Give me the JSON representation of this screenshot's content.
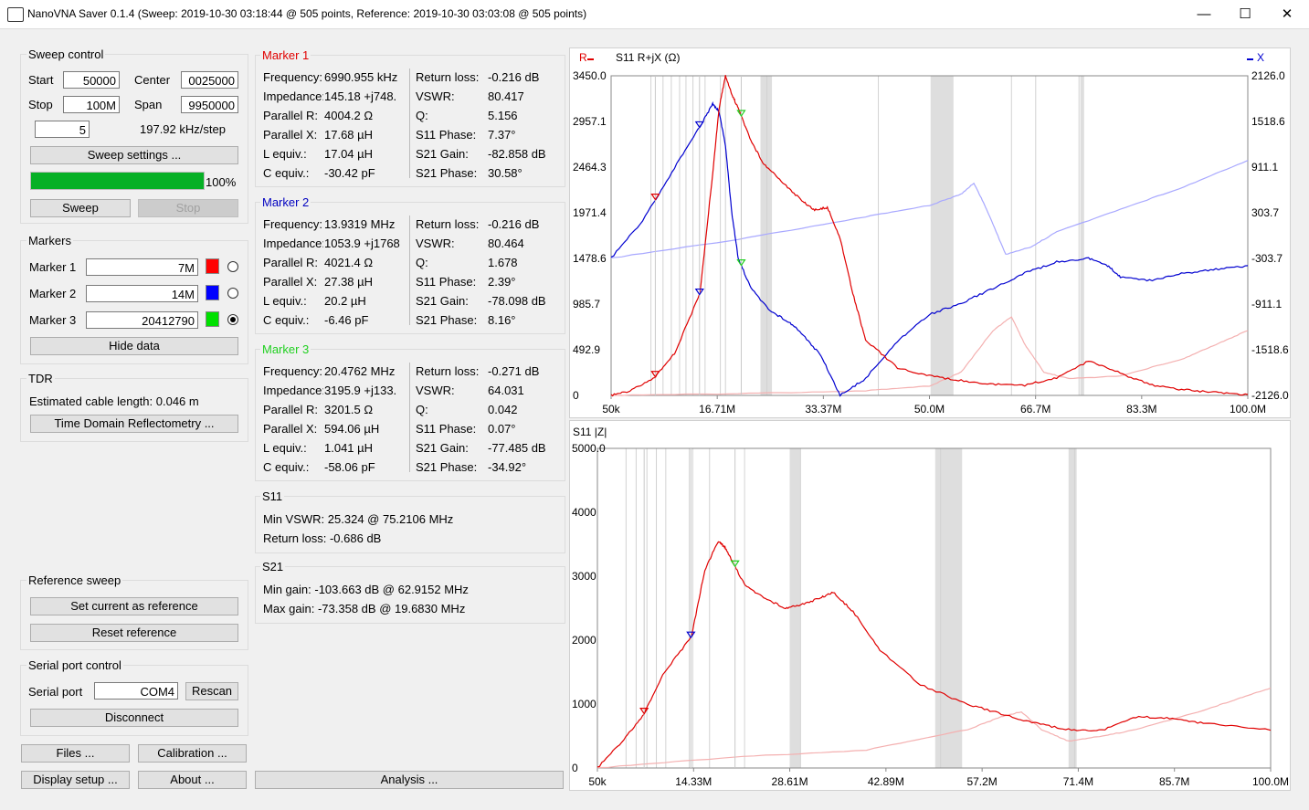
{
  "window": {
    "title": "NanoVNA Saver 0.1.4 (Sweep: 2019-10-30 03:18:44 @ 505 points, Reference: 2019-10-30 03:03:08 @ 505 points)"
  },
  "sweep": {
    "group_label": "Sweep control",
    "start_label": "Start",
    "start_value": "50000",
    "center_label": "Center",
    "center_value": "0025000",
    "stop_label": "Stop",
    "stop_value": "100M",
    "span_label": "Span",
    "span_value": "9950000",
    "count_value": "5",
    "step_text": "197.92 kHz/step",
    "settings_btn": "Sweep settings ...",
    "progress_text": "100%",
    "progress_value": 100,
    "sweep_btn": "Sweep",
    "stop_btn": "Stop"
  },
  "markers": {
    "group_label": "Markers",
    "items": [
      {
        "label": "Marker 1",
        "value": "7M",
        "color": "#ff0000",
        "selected": false
      },
      {
        "label": "Marker 2",
        "value": "14M",
        "color": "#0000ff",
        "selected": false
      },
      {
        "label": "Marker 3",
        "value": "20412790",
        "color": "#00e000",
        "selected": true
      }
    ],
    "hide_btn": "Hide data"
  },
  "tdr": {
    "group_label": "TDR",
    "cable_text": "Estimated cable length: 0.046 m",
    "btn": "Time Domain Reflectometry ..."
  },
  "reference": {
    "group_label": "Reference sweep",
    "set_btn": "Set current as reference",
    "reset_btn": "Reset reference"
  },
  "serial": {
    "group_label": "Serial port control",
    "port_label": "Serial port",
    "port_value": "COM4",
    "rescan_btn": "Rescan",
    "disconnect_btn": "Disconnect"
  },
  "bottom": {
    "files_btn": "Files ...",
    "calibration_btn": "Calibration ...",
    "display_btn": "Display setup ...",
    "about_btn": "About ...",
    "analysis_btn": "Analysis ..."
  },
  "marker_panels": [
    {
      "title": "Marker 1",
      "color": "#e00000",
      "left": [
        [
          "Frequency:",
          "6990.955 kHz"
        ],
        [
          "Impedance:",
          "145.18 +j748."
        ],
        [
          "Parallel R:",
          "4004.2 Ω"
        ],
        [
          "Parallel X:",
          "17.68 µH"
        ],
        [
          "L equiv.:",
          "17.04 µH"
        ],
        [
          "C equiv.:",
          "-30.42 pF"
        ]
      ],
      "right": [
        [
          "Return loss:",
          "-0.216 dB"
        ],
        [
          "VSWR:",
          "80.417"
        ],
        [
          "Q:",
          "5.156"
        ],
        [
          "S11 Phase:",
          "7.37°"
        ],
        [
          "S21 Gain:",
          "-82.858 dB"
        ],
        [
          "S21 Phase:",
          "30.58°"
        ]
      ]
    },
    {
      "title": "Marker 2",
      "color": "#0000c0",
      "left": [
        [
          "Frequency:",
          "13.9319 MHz"
        ],
        [
          "Impedance:",
          "1053.9 +j1768"
        ],
        [
          "Parallel R:",
          "4021.4 Ω"
        ],
        [
          "Parallel X:",
          "27.38 µH"
        ],
        [
          "L equiv.:",
          "20.2 µH"
        ],
        [
          "C equiv.:",
          "-6.46 pF"
        ]
      ],
      "right": [
        [
          "Return loss:",
          "-0.216 dB"
        ],
        [
          "VSWR:",
          "80.464"
        ],
        [
          "Q:",
          "1.678"
        ],
        [
          "S11 Phase:",
          "2.39°"
        ],
        [
          "S21 Gain:",
          "-78.098 dB"
        ],
        [
          "S21 Phase:",
          "8.16°"
        ]
      ]
    },
    {
      "title": "Marker 3",
      "color": "#20d020",
      "left": [
        [
          "Frequency:",
          "20.4762 MHz"
        ],
        [
          "Impedance:",
          "3195.9 +j133."
        ],
        [
          "Parallel R:",
          "3201.5 Ω"
        ],
        [
          "Parallel X:",
          "594.06 µH"
        ],
        [
          "L equiv.:",
          "1.041 µH"
        ],
        [
          "C equiv.:",
          "-58.06 pF"
        ]
      ],
      "right": [
        [
          "Return loss:",
          "-0.271 dB"
        ],
        [
          "VSWR:",
          "64.031"
        ],
        [
          "Q:",
          "0.042"
        ],
        [
          "S11 Phase:",
          "0.07°"
        ],
        [
          "S21 Gain:",
          "-77.485 dB"
        ],
        [
          "S21 Phase:",
          "-34.92°"
        ]
      ]
    }
  ],
  "s11_summary": {
    "title": "S11",
    "min_vswr": "Min VSWR:  25.324 @ 75.2106 MHz",
    "return_loss": "Return loss: -0.686 dB"
  },
  "s21_summary": {
    "title": "S21",
    "min_gain": "Min gain: -103.663 dB @ 62.9152 MHz",
    "max_gain": "Max gain: -73.358 dB @ 19.6830 MHz"
  },
  "chart_data": [
    {
      "type": "line",
      "title": "S11  R+jX (Ω)",
      "legend": {
        "left": "R",
        "right": "X"
      },
      "x_ticks": [
        "50k",
        "16.71M",
        "33.37M",
        "50.0M",
        "66.7M",
        "83.3M",
        "100.0M"
      ],
      "x_range": [
        0.05,
        100
      ],
      "y_left_ticks": [
        "3450.0",
        "2957.1",
        "2464.3",
        "1971.4",
        "1478.6",
        "985.7",
        "492.9",
        "0"
      ],
      "y_left_range": [
        0,
        3450
      ],
      "y_right_ticks": [
        "2126.0",
        "1518.6",
        "911.1",
        "303.7",
        "-303.7",
        "-911.1",
        "-1518.6",
        "-2126.0"
      ],
      "y_right_range": [
        -2126,
        2126
      ],
      "series": [
        {
          "name": "R",
          "axis": "left",
          "color": "#e00000",
          "x": [
            0.05,
            3,
            7,
            10,
            14,
            16,
            17,
            18,
            19,
            20,
            22,
            24,
            27,
            30,
            32,
            34,
            36,
            38,
            40,
            45,
            50,
            55,
            60,
            65,
            70,
            75,
            80,
            85,
            90,
            95,
            100
          ],
          "y": [
            0,
            50,
            200,
            450,
            1100,
            2400,
            3100,
            3450,
            3250,
            3100,
            2750,
            2500,
            2300,
            2100,
            2000,
            2030,
            1700,
            1100,
            600,
            300,
            210,
            160,
            120,
            110,
            190,
            370,
            240,
            110,
            60,
            30,
            10
          ]
        },
        {
          "name": "X",
          "axis": "right",
          "color": "#0000d0",
          "x": [
            0.05,
            5,
            10,
            14,
            16,
            17,
            18,
            19,
            20,
            22,
            25,
            28,
            30,
            33,
            36,
            40,
            45,
            50,
            55,
            60,
            65,
            70,
            75,
            78,
            80,
            85,
            90,
            95,
            100
          ],
          "y": [
            -300,
            200,
            900,
            1450,
            1750,
            1650,
            1200,
            300,
            -300,
            -700,
            -1000,
            -1150,
            -1300,
            -1600,
            -2126,
            -1900,
            -1400,
            -1050,
            -900,
            -700,
            -500,
            -350,
            -300,
            -400,
            -550,
            -600,
            -500,
            -450,
            -400
          ]
        },
        {
          "name": "R ref",
          "axis": "left",
          "color": "#f4b0b0",
          "x": [
            0.05,
            20,
            40,
            50,
            55,
            60,
            62.9,
            65,
            68,
            72,
            80,
            90,
            95,
            100
          ],
          "y": [
            0,
            20,
            50,
            100,
            250,
            700,
            850,
            550,
            250,
            180,
            210,
            400,
            550,
            700
          ]
        },
        {
          "name": "X ref",
          "axis": "right",
          "color": "#a8a8ff",
          "x": [
            0.05,
            20,
            40,
            50,
            55,
            57,
            59,
            62,
            66,
            70,
            80,
            90,
            100
          ],
          "y": [
            -300,
            -50,
            250,
            400,
            550,
            700,
            350,
            -250,
            -150,
            50,
            350,
            650,
            1000
          ]
        }
      ],
      "markers": [
        {
          "x": 6.99,
          "color": "#e00000"
        },
        {
          "x": 13.93,
          "color": "#0000d0"
        },
        {
          "x": 20.48,
          "color": "#20d020"
        }
      ]
    },
    {
      "type": "line",
      "title": "S11 |Z|",
      "x_ticks": [
        "50k",
        "14.33M",
        "28.61M",
        "42.89M",
        "57.2M",
        "71.4M",
        "85.7M",
        "100.0M"
      ],
      "x_range": [
        0.05,
        100
      ],
      "y_ticks": [
        "5000.0",
        "4000",
        "3000",
        "2000",
        "1000",
        "0"
      ],
      "y_range": [
        0,
        5000
      ],
      "series": [
        {
          "name": "|Z|",
          "color": "#e00000",
          "x": [
            0.05,
            4,
            7,
            10,
            14,
            16,
            18,
            19,
            20,
            22,
            25,
            28,
            30,
            33,
            35,
            38,
            42,
            48,
            55,
            60,
            65,
            70,
            75,
            80,
            85,
            90,
            100
          ],
          "y": [
            0,
            450,
            850,
            1500,
            2050,
            3100,
            3550,
            3450,
            3250,
            2850,
            2650,
            2500,
            2550,
            2650,
            2750,
            2450,
            1850,
            1300,
            1000,
            850,
            700,
            600,
            590,
            800,
            780,
            700,
            590
          ]
        },
        {
          "name": "|Z| ref",
          "color": "#f4b0b0",
          "x": [
            0.05,
            20,
            40,
            55,
            60,
            63,
            66,
            70,
            75,
            80,
            90,
            95,
            100
          ],
          "y": [
            0,
            170,
            280,
            600,
            800,
            880,
            600,
            420,
            500,
            600,
            900,
            1080,
            1250
          ]
        }
      ],
      "markers": [
        {
          "x": 6.99,
          "color": "#e00000"
        },
        {
          "x": 13.93,
          "color": "#0000d0"
        },
        {
          "x": 20.48,
          "color": "#20d020"
        }
      ]
    }
  ]
}
